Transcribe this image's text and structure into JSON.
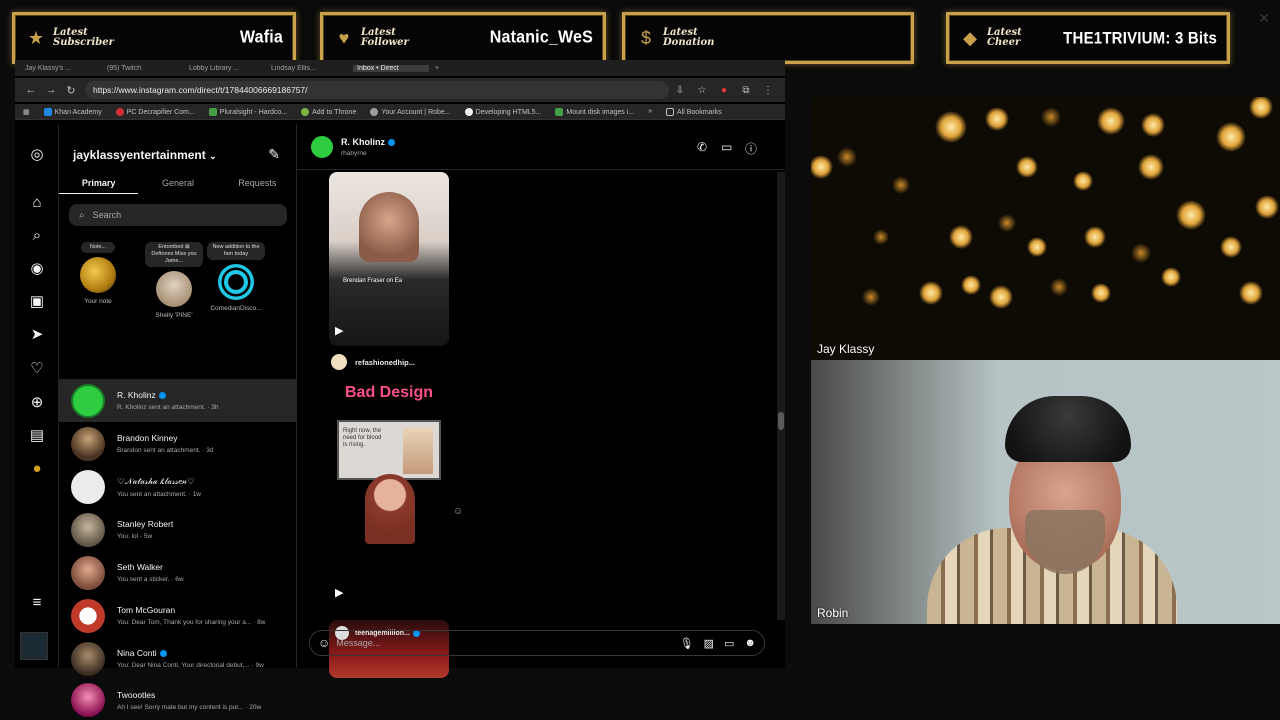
{
  "alerts": [
    {
      "label": "Latest Subscriber",
      "value": "Wafia",
      "icon": "star-icon"
    },
    {
      "label": "Latest Follower",
      "value": "Natanic_WeS",
      "icon": "heart-icon"
    },
    {
      "label": "Latest Donation",
      "value": "",
      "icon": "dollar-icon"
    },
    {
      "label": "Latest Cheer",
      "value": "THE1TRIVIUM: 3 Bits",
      "icon": "diamond-icon"
    }
  ],
  "browser": {
    "tabs": [
      "Jay Klassy's ...",
      "(95) Twitch",
      "Lobby Library ...",
      "Lindsay Ellis...",
      "Inbox • Direct"
    ],
    "url": "https://www.instagram.com/direct/t/17844006669186757/",
    "bookmarks": [
      "Khan Academy",
      "PC Decrapifier Com...",
      "Pluralsight - Hardco...",
      "Add to Throne",
      "Your Account | Robe...",
      "Developing HTML5...",
      "Mount disk images i..."
    ],
    "all_bookmarks": "All Bookmarks"
  },
  "instagram": {
    "account": "jayklassyentertainment",
    "tabs": [
      "Primary",
      "General",
      "Requests"
    ],
    "search_placeholder": "Search",
    "notes": [
      {
        "bubble": "Note...",
        "name": "Your note"
      },
      {
        "bubble": "Entombed ⊠ Deftones Miss you Jame...",
        "name": "Shelly 'PINE'"
      },
      {
        "bubble": "New addition to the fam today",
        "name": "ComedianDisco..."
      }
    ],
    "threads": [
      {
        "name": "R. Kholinz",
        "preview": "R. Kholinz sent an attachment. · 3h",
        "verified": true,
        "color": "#2ecc40"
      },
      {
        "name": "Brandon Kinney",
        "preview": "Brandon sent an attachment. · 3d",
        "verified": false,
        "color": "#6b4a2f"
      },
      {
        "name": "♡𝒩𝒶𝓉𝒶𝓈𝒽𝒶 𝓀𝓁𝒶𝓈𝓈𝑒𝓃♡",
        "preview": "You sent an attachment. · 1w",
        "verified": false,
        "color": "#e8e8e8"
      },
      {
        "name": "Stanley Robert",
        "preview": "You: lol · 5w",
        "verified": false,
        "color": "#8a7a66"
      },
      {
        "name": "Seth Walker",
        "preview": "You sent a sticker. · 6w",
        "verified": false,
        "color": "#9a6b55"
      },
      {
        "name": "Tom McGouran",
        "preview": "You: Dear Tom, Thank you for sharing your a... · 8w",
        "verified": false,
        "color": "#c0392b"
      },
      {
        "name": "Nina Conti",
        "preview": "You: Dear Nina Conti, Your directorial debut,... · 9w",
        "verified": true,
        "color": "#5d4d3d"
      },
      {
        "name": "Twoootles",
        "preview": "Ah I see! Sorry mate but my content is pur... · 20w",
        "verified": false,
        "color": "#c2185b"
      }
    ],
    "chat": {
      "name": "R. Kholinz",
      "username": "rhabyrne",
      "reel1_caption": "Brendan Fraser on Ea",
      "reel2_user": "refashionedhip...",
      "reel2_title": "Bad Design",
      "reel2_sign": "Right now, the need for blood is rising.",
      "reel3_user": "teenagemillion...",
      "composer_placeholder": "Message..."
    }
  },
  "cams": [
    {
      "label": "Jay Klassy"
    },
    {
      "label": "Robin"
    }
  ]
}
